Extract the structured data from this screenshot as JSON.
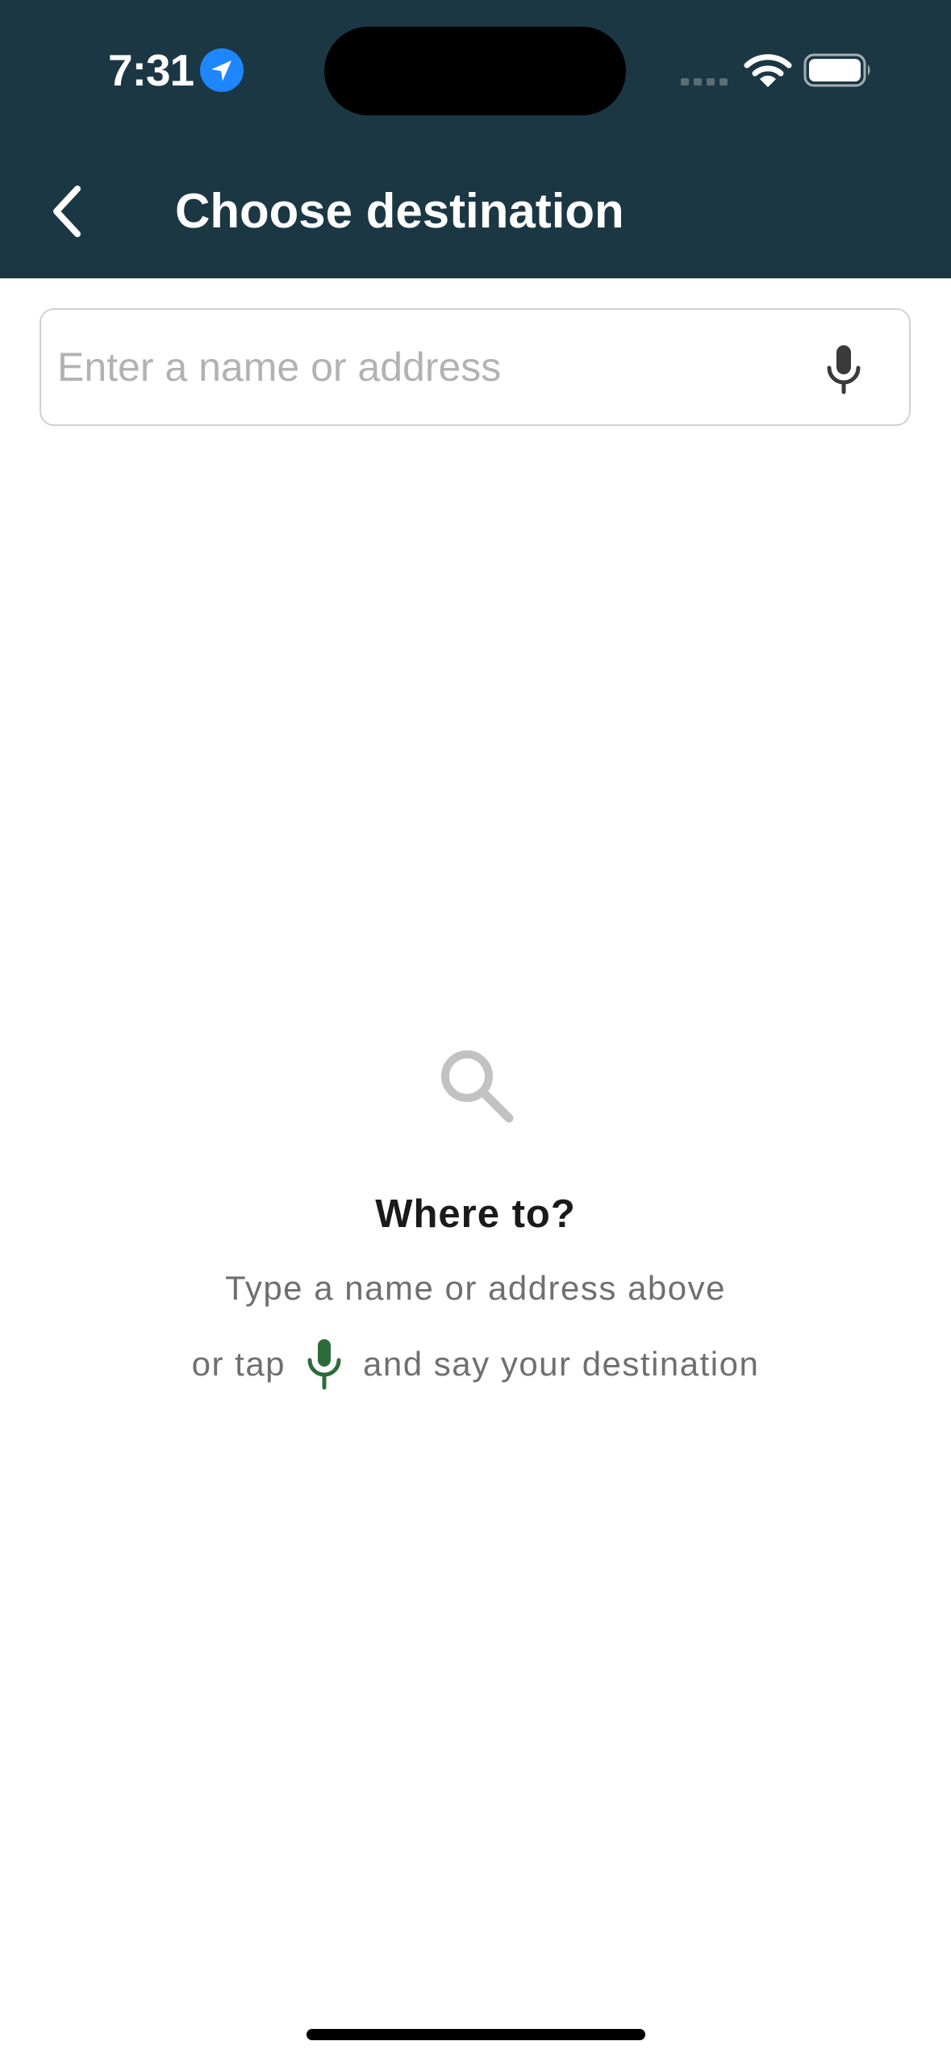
{
  "status_bar": {
    "time": "7:31",
    "icons": [
      "location-arrow-icon",
      "cellular-signal-icon",
      "wifi-icon",
      "battery-icon"
    ]
  },
  "header": {
    "title": "Choose destination",
    "back_icon": "chevron-left-icon",
    "background_color": "#1c3744"
  },
  "search": {
    "placeholder": "Enter a name or address",
    "value": "",
    "mic_icon": "microphone-icon"
  },
  "empty_state": {
    "icon": "magnifier-icon",
    "title": "Where to?",
    "line1": "Type a name or address above",
    "line2_before": "or tap",
    "line2_icon": "microphone-icon",
    "line2_after": "and say your destination",
    "accent_color": "#2e6b3a"
  }
}
